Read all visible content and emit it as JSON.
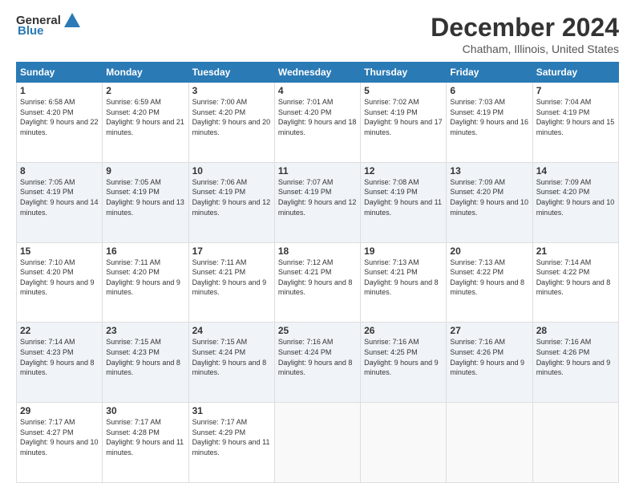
{
  "header": {
    "logo_general": "General",
    "logo_blue": "Blue",
    "month": "December 2024",
    "location": "Chatham, Illinois, United States"
  },
  "weekdays": [
    "Sunday",
    "Monday",
    "Tuesday",
    "Wednesday",
    "Thursday",
    "Friday",
    "Saturday"
  ],
  "weeks": [
    [
      {
        "day": "1",
        "sunrise": "6:58 AM",
        "sunset": "4:20 PM",
        "daylight": "9 hours and 22 minutes."
      },
      {
        "day": "2",
        "sunrise": "6:59 AM",
        "sunset": "4:20 PM",
        "daylight": "9 hours and 21 minutes."
      },
      {
        "day": "3",
        "sunrise": "7:00 AM",
        "sunset": "4:20 PM",
        "daylight": "9 hours and 20 minutes."
      },
      {
        "day": "4",
        "sunrise": "7:01 AM",
        "sunset": "4:20 PM",
        "daylight": "9 hours and 18 minutes."
      },
      {
        "day": "5",
        "sunrise": "7:02 AM",
        "sunset": "4:19 PM",
        "daylight": "9 hours and 17 minutes."
      },
      {
        "day": "6",
        "sunrise": "7:03 AM",
        "sunset": "4:19 PM",
        "daylight": "9 hours and 16 minutes."
      },
      {
        "day": "7",
        "sunrise": "7:04 AM",
        "sunset": "4:19 PM",
        "daylight": "9 hours and 15 minutes."
      }
    ],
    [
      {
        "day": "8",
        "sunrise": "7:05 AM",
        "sunset": "4:19 PM",
        "daylight": "9 hours and 14 minutes."
      },
      {
        "day": "9",
        "sunrise": "7:05 AM",
        "sunset": "4:19 PM",
        "daylight": "9 hours and 13 minutes."
      },
      {
        "day": "10",
        "sunrise": "7:06 AM",
        "sunset": "4:19 PM",
        "daylight": "9 hours and 12 minutes."
      },
      {
        "day": "11",
        "sunrise": "7:07 AM",
        "sunset": "4:19 PM",
        "daylight": "9 hours and 12 minutes."
      },
      {
        "day": "12",
        "sunrise": "7:08 AM",
        "sunset": "4:19 PM",
        "daylight": "9 hours and 11 minutes."
      },
      {
        "day": "13",
        "sunrise": "7:09 AM",
        "sunset": "4:20 PM",
        "daylight": "9 hours and 10 minutes."
      },
      {
        "day": "14",
        "sunrise": "7:09 AM",
        "sunset": "4:20 PM",
        "daylight": "9 hours and 10 minutes."
      }
    ],
    [
      {
        "day": "15",
        "sunrise": "7:10 AM",
        "sunset": "4:20 PM",
        "daylight": "9 hours and 9 minutes."
      },
      {
        "day": "16",
        "sunrise": "7:11 AM",
        "sunset": "4:20 PM",
        "daylight": "9 hours and 9 minutes."
      },
      {
        "day": "17",
        "sunrise": "7:11 AM",
        "sunset": "4:21 PM",
        "daylight": "9 hours and 9 minutes."
      },
      {
        "day": "18",
        "sunrise": "7:12 AM",
        "sunset": "4:21 PM",
        "daylight": "9 hours and 8 minutes."
      },
      {
        "day": "19",
        "sunrise": "7:13 AM",
        "sunset": "4:21 PM",
        "daylight": "9 hours and 8 minutes."
      },
      {
        "day": "20",
        "sunrise": "7:13 AM",
        "sunset": "4:22 PM",
        "daylight": "9 hours and 8 minutes."
      },
      {
        "day": "21",
        "sunrise": "7:14 AM",
        "sunset": "4:22 PM",
        "daylight": "9 hours and 8 minutes."
      }
    ],
    [
      {
        "day": "22",
        "sunrise": "7:14 AM",
        "sunset": "4:23 PM",
        "daylight": "9 hours and 8 minutes."
      },
      {
        "day": "23",
        "sunrise": "7:15 AM",
        "sunset": "4:23 PM",
        "daylight": "9 hours and 8 minutes."
      },
      {
        "day": "24",
        "sunrise": "7:15 AM",
        "sunset": "4:24 PM",
        "daylight": "9 hours and 8 minutes."
      },
      {
        "day": "25",
        "sunrise": "7:16 AM",
        "sunset": "4:24 PM",
        "daylight": "9 hours and 8 minutes."
      },
      {
        "day": "26",
        "sunrise": "7:16 AM",
        "sunset": "4:25 PM",
        "daylight": "9 hours and 9 minutes."
      },
      {
        "day": "27",
        "sunrise": "7:16 AM",
        "sunset": "4:26 PM",
        "daylight": "9 hours and 9 minutes."
      },
      {
        "day": "28",
        "sunrise": "7:16 AM",
        "sunset": "4:26 PM",
        "daylight": "9 hours and 9 minutes."
      }
    ],
    [
      {
        "day": "29",
        "sunrise": "7:17 AM",
        "sunset": "4:27 PM",
        "daylight": "9 hours and 10 minutes."
      },
      {
        "day": "30",
        "sunrise": "7:17 AM",
        "sunset": "4:28 PM",
        "daylight": "9 hours and 11 minutes."
      },
      {
        "day": "31",
        "sunrise": "7:17 AM",
        "sunset": "4:29 PM",
        "daylight": "9 hours and 11 minutes."
      },
      null,
      null,
      null,
      null
    ]
  ]
}
